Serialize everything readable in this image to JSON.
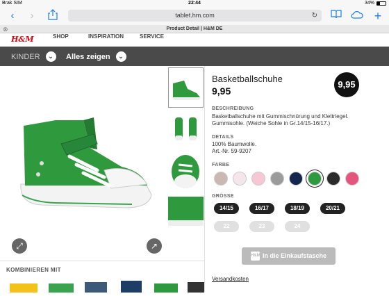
{
  "status_bar": {
    "carrier": "Brak SIM",
    "time": "22:44",
    "battery": "34%"
  },
  "browser": {
    "url": "tablet.hm.com",
    "tab_title": "Product Detail | H&M DE",
    "icons": [
      "back-chevron-icon",
      "forward-chevron-icon",
      "share-icon",
      "reload-icon",
      "bookmarks-icon",
      "cloud-icon",
      "new-tab-icon"
    ]
  },
  "site": {
    "logo": "H&M",
    "nav": [
      "SHOP",
      "INSPIRATION",
      "SERVICE"
    ]
  },
  "category_bar": {
    "category": "KINDER",
    "filter": "Alles zeigen"
  },
  "product": {
    "name": "Basketballschuhe",
    "price": "9,95",
    "price_badge": "9,95",
    "description_label": "BESCHREIBUNG",
    "description": "Basketballschuhe mit Gummischnürung und Klettriegel. Gummisohle. (Weiche Sohle in Gr.14/15-16/17.)",
    "details_label": "DETAILS",
    "details_material": "100% Baumwolle.",
    "details_article": "Art.-Nr. 59-9207",
    "color_label": "FARBE",
    "colors": [
      "#c9b9b0",
      "#f4e6ea",
      "#f7c7d3",
      "#9b9b9b",
      "#13264d",
      "#2e9a3f",
      "#2b2b2b",
      "#e5567f"
    ],
    "selected_color_index": 5,
    "size_label": "GRÖSSE",
    "sizes_available": [
      "14/15",
      "16/17",
      "18/19",
      "20/21"
    ],
    "sizes_unavailable": [
      "22",
      "23",
      "24"
    ],
    "cart_label": "In die Einkaufstasche",
    "shipping_link": "Versandkosten",
    "combine_label": "KOMBINIEREN MIT"
  }
}
